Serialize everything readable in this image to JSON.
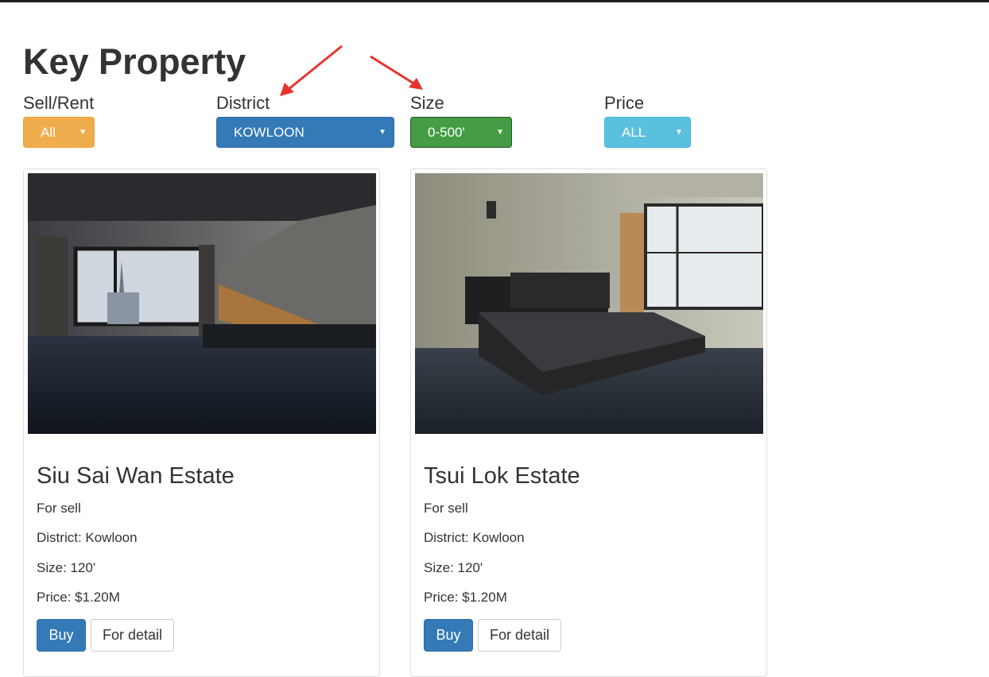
{
  "page": {
    "title": "Key Property"
  },
  "filters": {
    "sell_rent": {
      "label": "Sell/Rent",
      "value": "All"
    },
    "district": {
      "label": "District",
      "value": "KOWLOON"
    },
    "size": {
      "label": "Size",
      "value": "0-500'"
    },
    "price": {
      "label": "Price",
      "value": "ALL"
    }
  },
  "listings": [
    {
      "name": "Siu Sai Wan Estate",
      "type": "For sell",
      "district": "District: Kowloon",
      "size": "Size: 120'",
      "price": "Price: $1.20M",
      "buy_label": "Buy",
      "detail_label": "For detail",
      "image": "living-room-photo"
    },
    {
      "name": "Tsui Lok Estate",
      "type": "For sell",
      "district": "District: Kowloon",
      "size": "Size: 120'",
      "price": "Price: $1.20M",
      "buy_label": "Buy",
      "detail_label": "For detail",
      "image": "bedroom-photo"
    }
  ],
  "colors": {
    "sell_rent": "#f0ad4e",
    "district": "#337ab7",
    "size": "#449d44",
    "price": "#5bc0de",
    "annotation_arrow": "#e8332e"
  }
}
